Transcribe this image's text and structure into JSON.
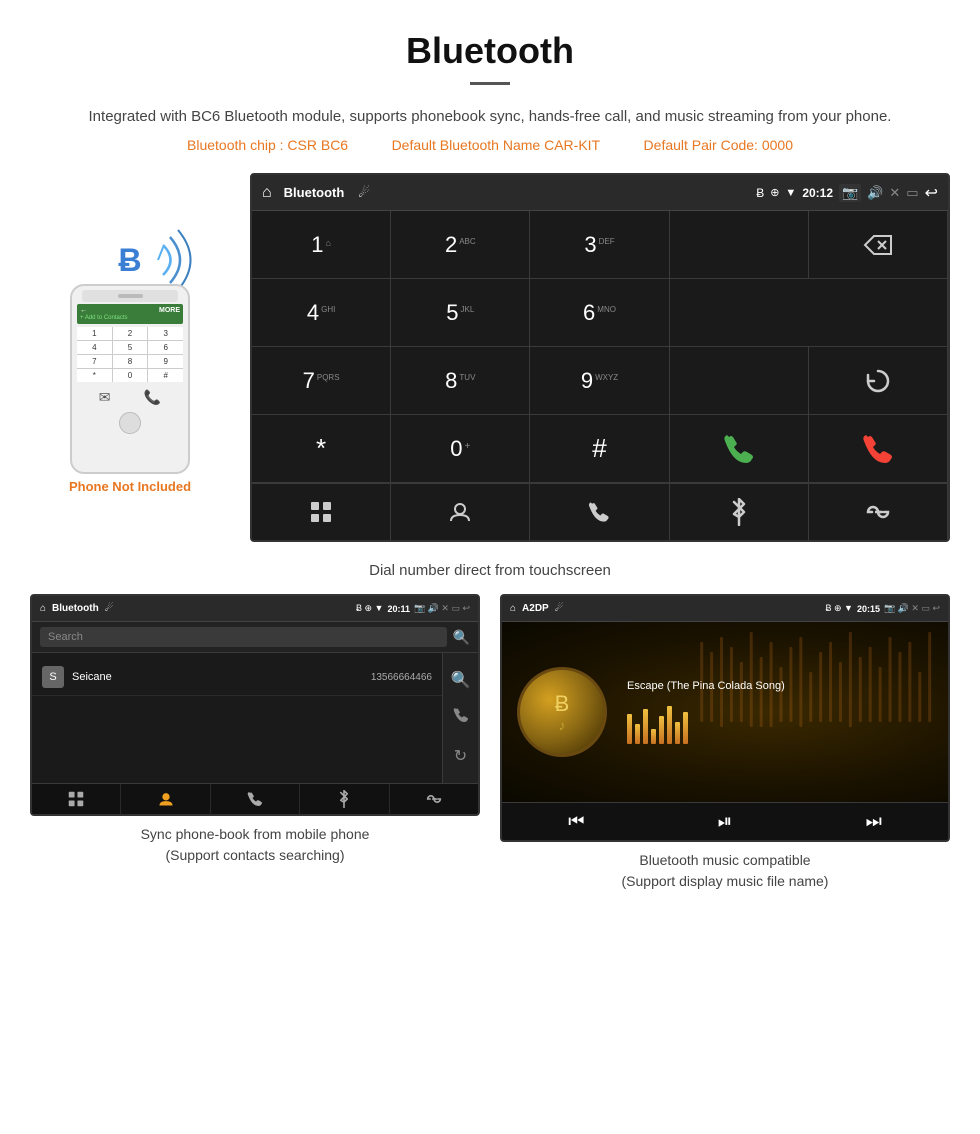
{
  "header": {
    "title": "Bluetooth",
    "description": "Integrated with BC6 Bluetooth module, supports phonebook sync, hands-free call, and music streaming from your phone.",
    "specs": {
      "chip": "Bluetooth chip : CSR BC6",
      "name": "Default Bluetooth Name CAR-KIT",
      "code": "Default Pair Code: 0000"
    }
  },
  "phone_label": "Phone Not Included",
  "car_screen": {
    "title": "Bluetooth",
    "time": "20:12",
    "dialpad": {
      "keys": [
        {
          "number": "1",
          "letters": "⌂"
        },
        {
          "number": "2",
          "letters": "ABC"
        },
        {
          "number": "3",
          "letters": "DEF"
        },
        {
          "number": "4",
          "letters": "GHI"
        },
        {
          "number": "5",
          "letters": "JKL"
        },
        {
          "number": "6",
          "letters": "MNO"
        },
        {
          "number": "7",
          "letters": "PQRS"
        },
        {
          "number": "8",
          "letters": "TUV"
        },
        {
          "number": "9",
          "letters": "WXYZ"
        },
        {
          "number": "*",
          "letters": ""
        },
        {
          "number": "0",
          "letters": "+"
        },
        {
          "number": "#",
          "letters": ""
        }
      ]
    },
    "bottom_icons": [
      "grid",
      "person",
      "phone",
      "bluetooth",
      "link"
    ]
  },
  "caption_main": "Dial number direct from touchscreen",
  "phonebook_screen": {
    "status_title": "Bluetooth",
    "time": "20:11",
    "search_placeholder": "Search",
    "contacts": [
      {
        "initial": "S",
        "name": "Seicane",
        "number": "13566664466"
      }
    ],
    "bottom_icons": [
      "grid",
      "person-active",
      "phone",
      "bluetooth",
      "link"
    ]
  },
  "music_screen": {
    "status_title": "A2DP",
    "time": "20:15",
    "song_title": "Escape (The Pina Colada Song)",
    "controls": [
      "prev",
      "play-pause",
      "next"
    ]
  },
  "caption_phonebook": "Sync phone-book from mobile phone",
  "caption_phonebook_sub": "(Support contacts searching)",
  "caption_music": "Bluetooth music compatible",
  "caption_music_sub": "(Support display music file name)",
  "colors": {
    "orange": "#e87722",
    "screen_bg": "#1a1a1a",
    "screen_border": "#333333",
    "status_bg": "#2a2a2a"
  }
}
